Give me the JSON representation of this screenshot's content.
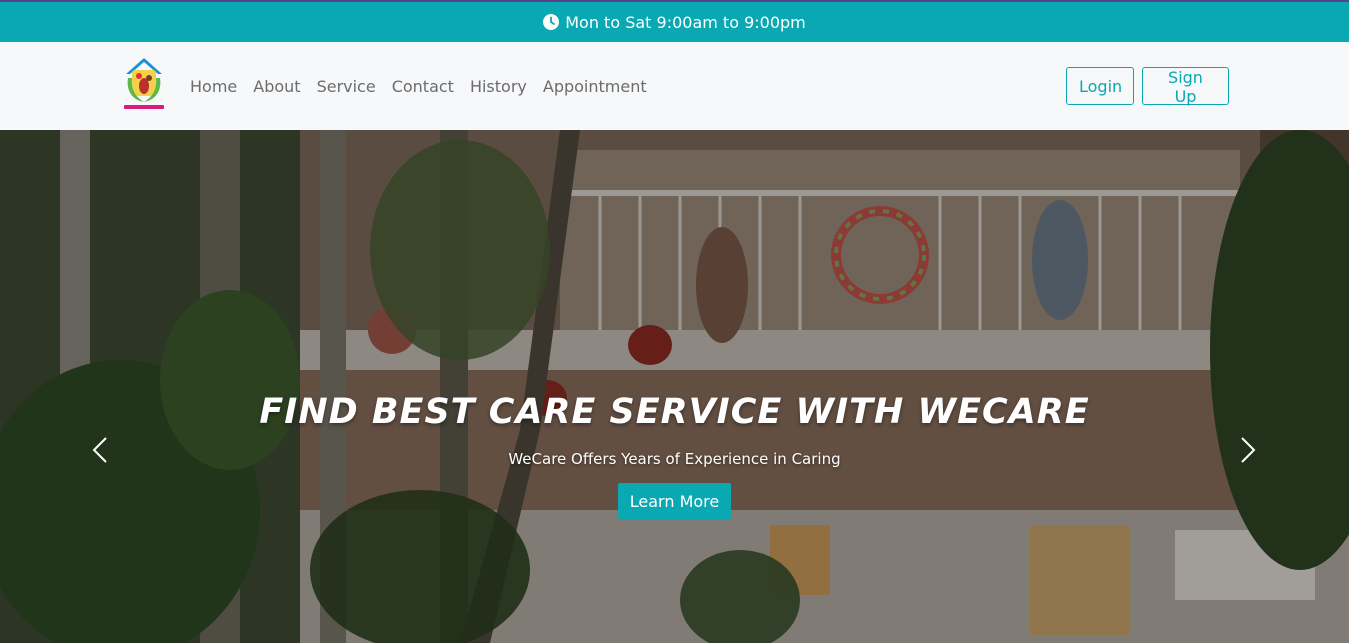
{
  "topbar": {
    "hours": "Mon to Sat 9:00am to 9:00pm",
    "icon": "clock-icon"
  },
  "nav": {
    "items": [
      {
        "label": "Home"
      },
      {
        "label": "About"
      },
      {
        "label": "Service"
      },
      {
        "label": "Contact"
      },
      {
        "label": "History"
      },
      {
        "label": "Appointment"
      }
    ],
    "login_label": "Login",
    "signup_label": "Sign Up"
  },
  "hero": {
    "title": "FIND BEST CARE SERVICE WITH WECARE",
    "subtitle": "WeCare Offers Years of Experience in Caring",
    "button_label": "Learn More",
    "prev_icon": "chevron-left-icon",
    "next_icon": "chevron-right-icon"
  },
  "colors": {
    "accent": "#0aa8b2",
    "topbar_border": "#5a3f8c",
    "nav_bg": "#f7f8fa",
    "nav_text": "#6c6c6c"
  }
}
